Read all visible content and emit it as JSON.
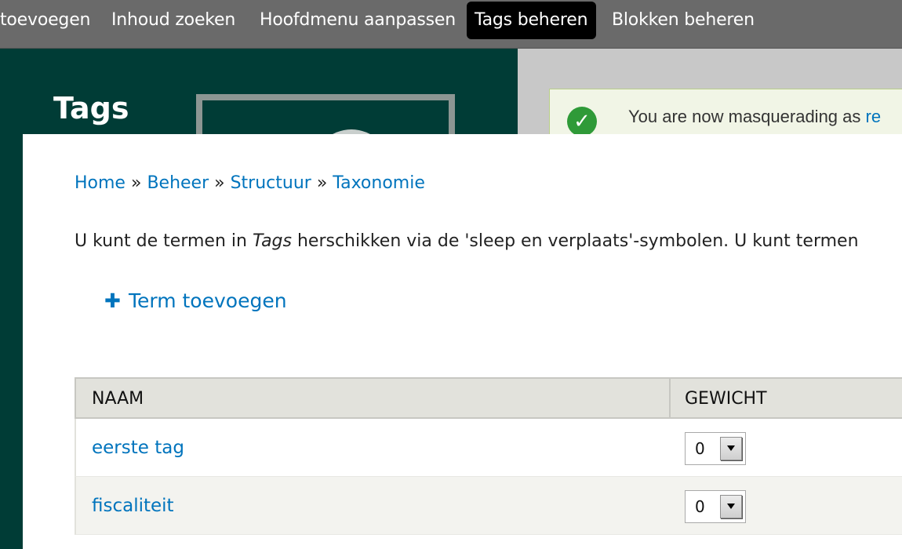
{
  "shortcuts": [
    {
      "label": "toevoegen",
      "active": false
    },
    {
      "label": "Inhoud zoeken",
      "active": false
    },
    {
      "label": "Hoofdmenu aanpassen",
      "active": false
    },
    {
      "label": "Tags beheren",
      "active": true
    },
    {
      "label": "Blokken beheren",
      "active": false
    }
  ],
  "page": {
    "title": "Tags"
  },
  "message": {
    "text": "You are now masquerading as ",
    "link": "re"
  },
  "breadcrumb": [
    {
      "label": "Home"
    },
    {
      "label": "Beheer"
    },
    {
      "label": "Structuur"
    },
    {
      "label": "Taxonomie"
    }
  ],
  "breadcrumb_separator": "»",
  "help": {
    "before": "U kunt de termen in ",
    "emphasis": "Tags",
    "after": " herschikken via de 'sleep en verplaats'-symbolen. U kunt termen"
  },
  "action": {
    "icon": "plus-icon",
    "label": "Term toevoegen"
  },
  "table": {
    "headers": {
      "name": "Naam",
      "weight": "Gewicht"
    },
    "rows": [
      {
        "name": "eerste tag",
        "weight": "0"
      },
      {
        "name": "fiscaliteit",
        "weight": "0"
      }
    ]
  },
  "colors": {
    "link": "#0074bd",
    "header_bg": "#003c36",
    "toolbar_bg": "#6a6a6a",
    "status_ok": "#2f9a38"
  }
}
